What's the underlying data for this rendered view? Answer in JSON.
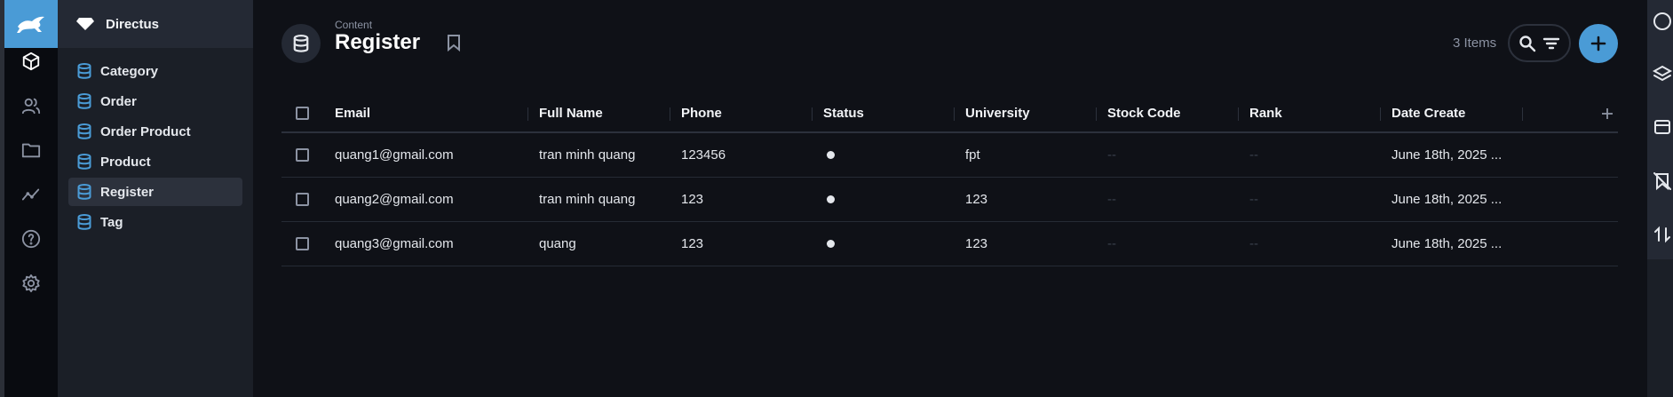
{
  "module_bar": {
    "logo": "directus-rabbit-icon",
    "items": [
      {
        "icon": "content-box-icon",
        "active": true
      },
      {
        "icon": "users-icon"
      },
      {
        "icon": "files-folder-icon"
      },
      {
        "icon": "insights-icon"
      },
      {
        "icon": "help-icon"
      },
      {
        "icon": "settings-gear-icon"
      }
    ]
  },
  "project": {
    "name": "Directus",
    "icon": "diamond-icon"
  },
  "collections": [
    {
      "label": "Category"
    },
    {
      "label": "Order"
    },
    {
      "label": "Order Product"
    },
    {
      "label": "Product"
    },
    {
      "label": "Register",
      "active": true
    },
    {
      "label": "Tag"
    }
  ],
  "header": {
    "breadcrumb": "Content",
    "title": "Register",
    "count": "3 Items"
  },
  "table": {
    "columns": [
      "Email",
      "Full Name",
      "Phone",
      "Status",
      "University",
      "Stock Code",
      "Rank",
      "Date Create"
    ],
    "rows": [
      {
        "email": "quang1@gmail.com",
        "full_name": "tran minh quang",
        "phone": "123456",
        "university": "fpt",
        "stock_code": "--",
        "rank": "--",
        "date_create": "June 18th, 2025 ..."
      },
      {
        "email": "quang2@gmail.com",
        "full_name": "tran minh quang",
        "phone": "123",
        "university": "123",
        "stock_code": "--",
        "rank": "--",
        "date_create": "June 18th, 2025 ..."
      },
      {
        "email": "quang3@gmail.com",
        "full_name": "quang",
        "phone": "123",
        "university": "123",
        "stock_code": "--",
        "rank": "--",
        "date_create": "June 18th, 2025 ..."
      }
    ]
  },
  "colors": {
    "accent": "#4a9bd6",
    "background": "#0f1117",
    "sidebar": "#1b1f27"
  }
}
